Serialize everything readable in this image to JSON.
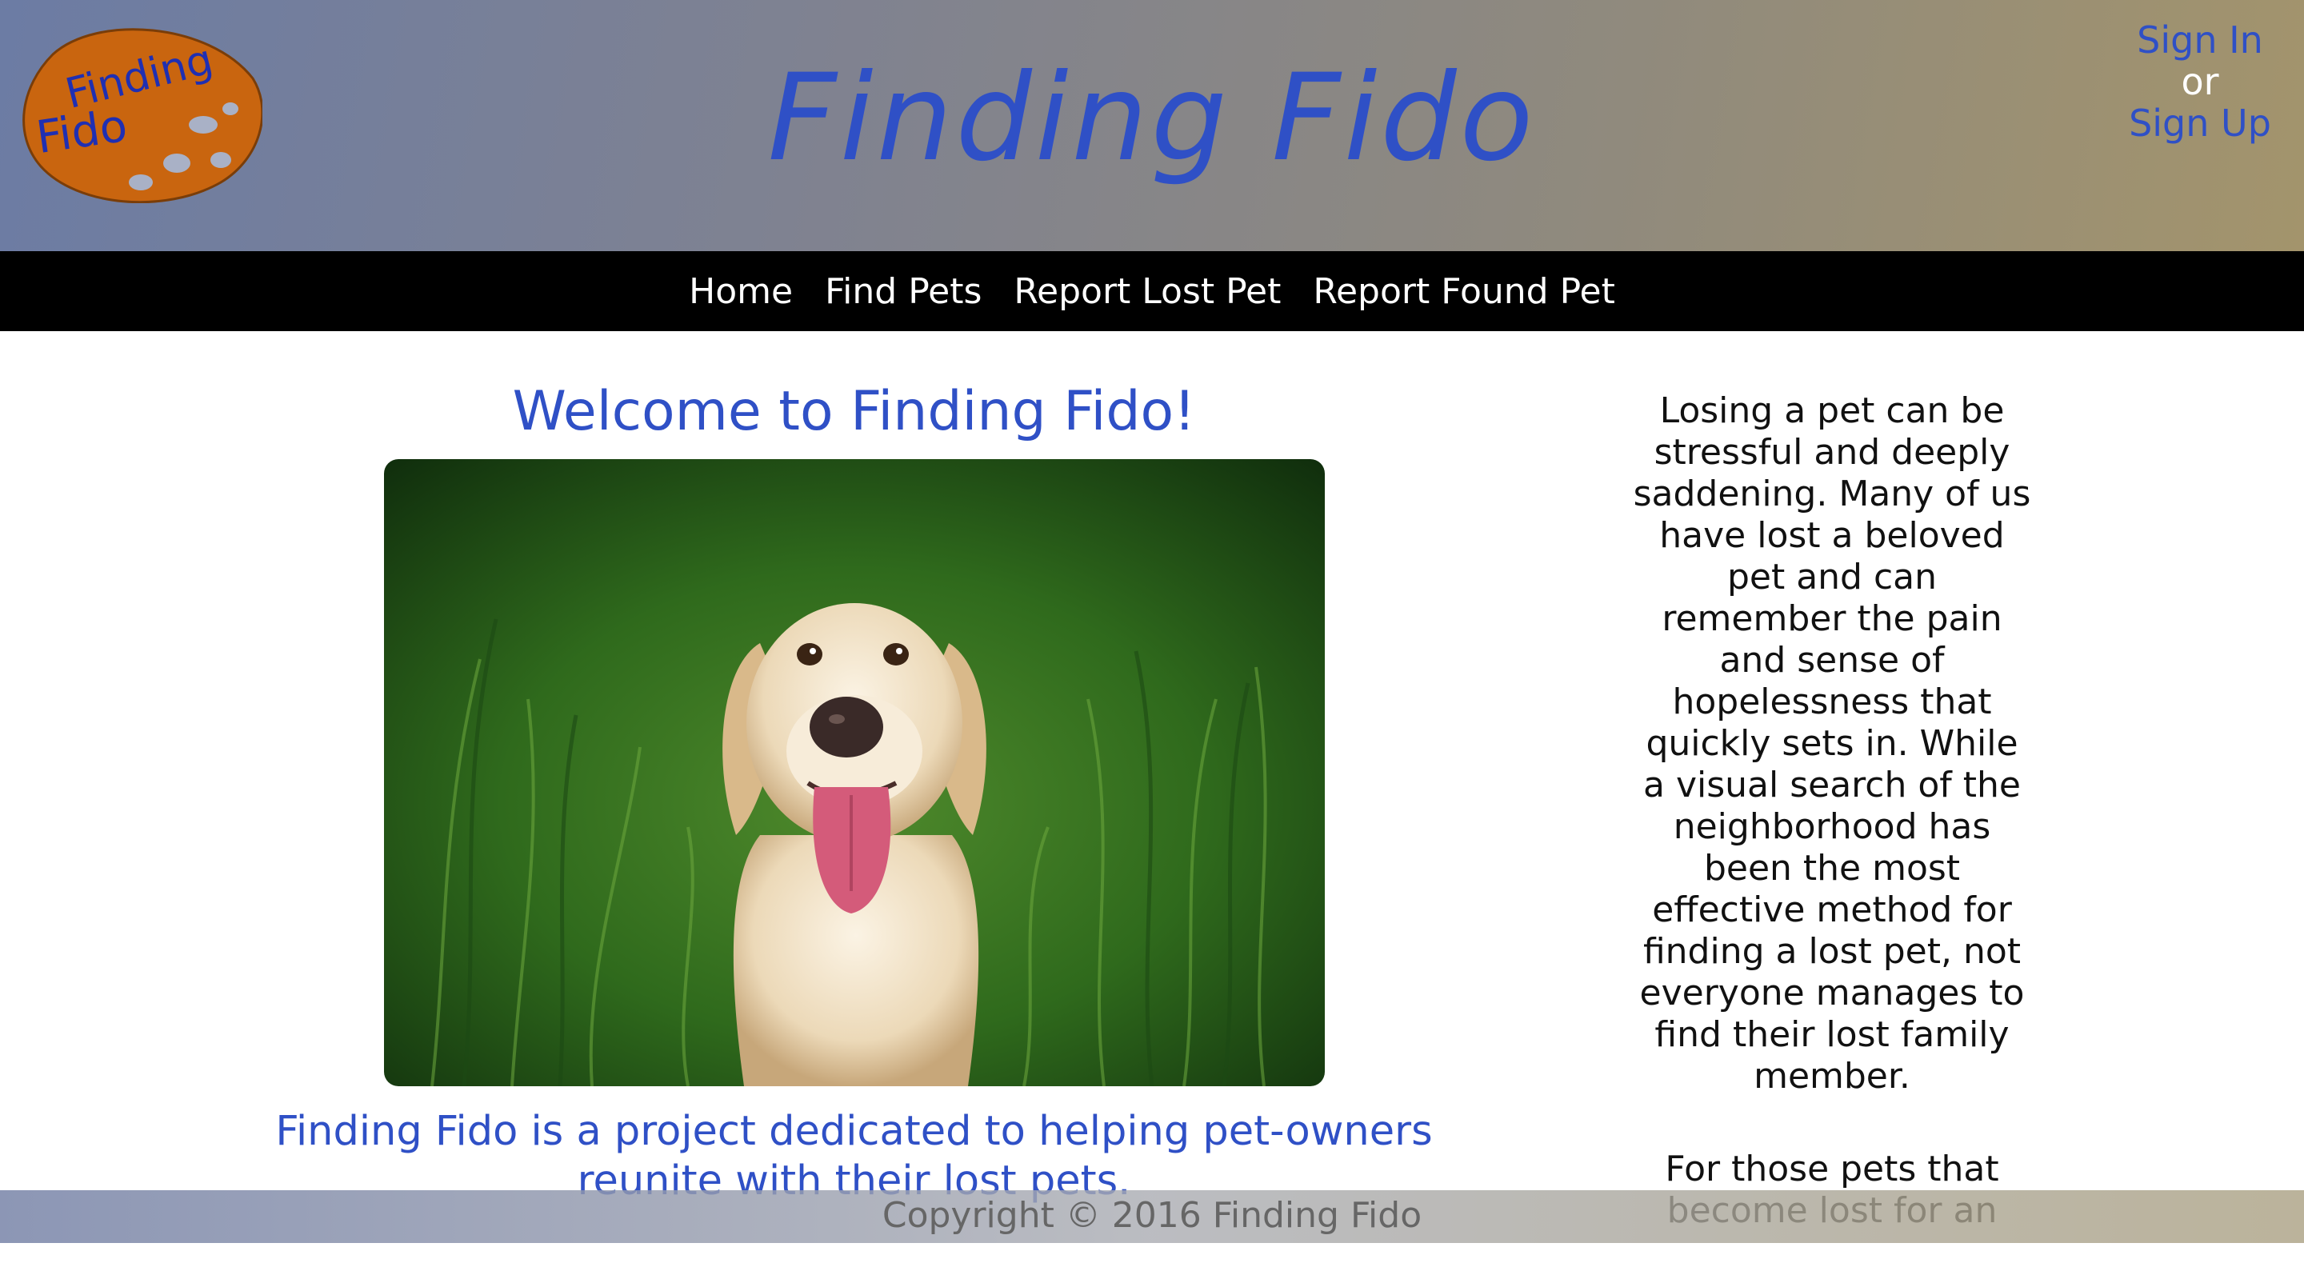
{
  "header": {
    "logo_text_line1": "Finding",
    "logo_text_line2": "Fido",
    "title": "Finding Fido",
    "sign_in": "Sign In",
    "or": "or",
    "sign_up": "Sign Up"
  },
  "nav": {
    "items": [
      {
        "label": "Home"
      },
      {
        "label": "Find Pets"
      },
      {
        "label": "Report Lost Pet"
      },
      {
        "label": "Report Found Pet"
      }
    ]
  },
  "main": {
    "welcome": "Welcome to Finding Fido!",
    "tagline": "Finding Fido is a project dedicated to helping pet-owners reunite with their lost pets."
  },
  "aside": {
    "paragraph1": "Losing a pet can be stressful and deeply saddening. Many of us have lost a beloved pet and can remember the pain and sense of hopelessness that quickly sets in. While a visual search of the neighborhood has been the most effective method for finding a lost pet, not everyone manages to find their lost family member.",
    "paragraph2": "For those pets that become lost for an"
  },
  "footer": {
    "copyright": "Copyright © 2016 Finding Fido"
  },
  "colors": {
    "accent": "#2f50c6",
    "logo_orange": "#c9650f",
    "nav_bg": "#000000"
  }
}
